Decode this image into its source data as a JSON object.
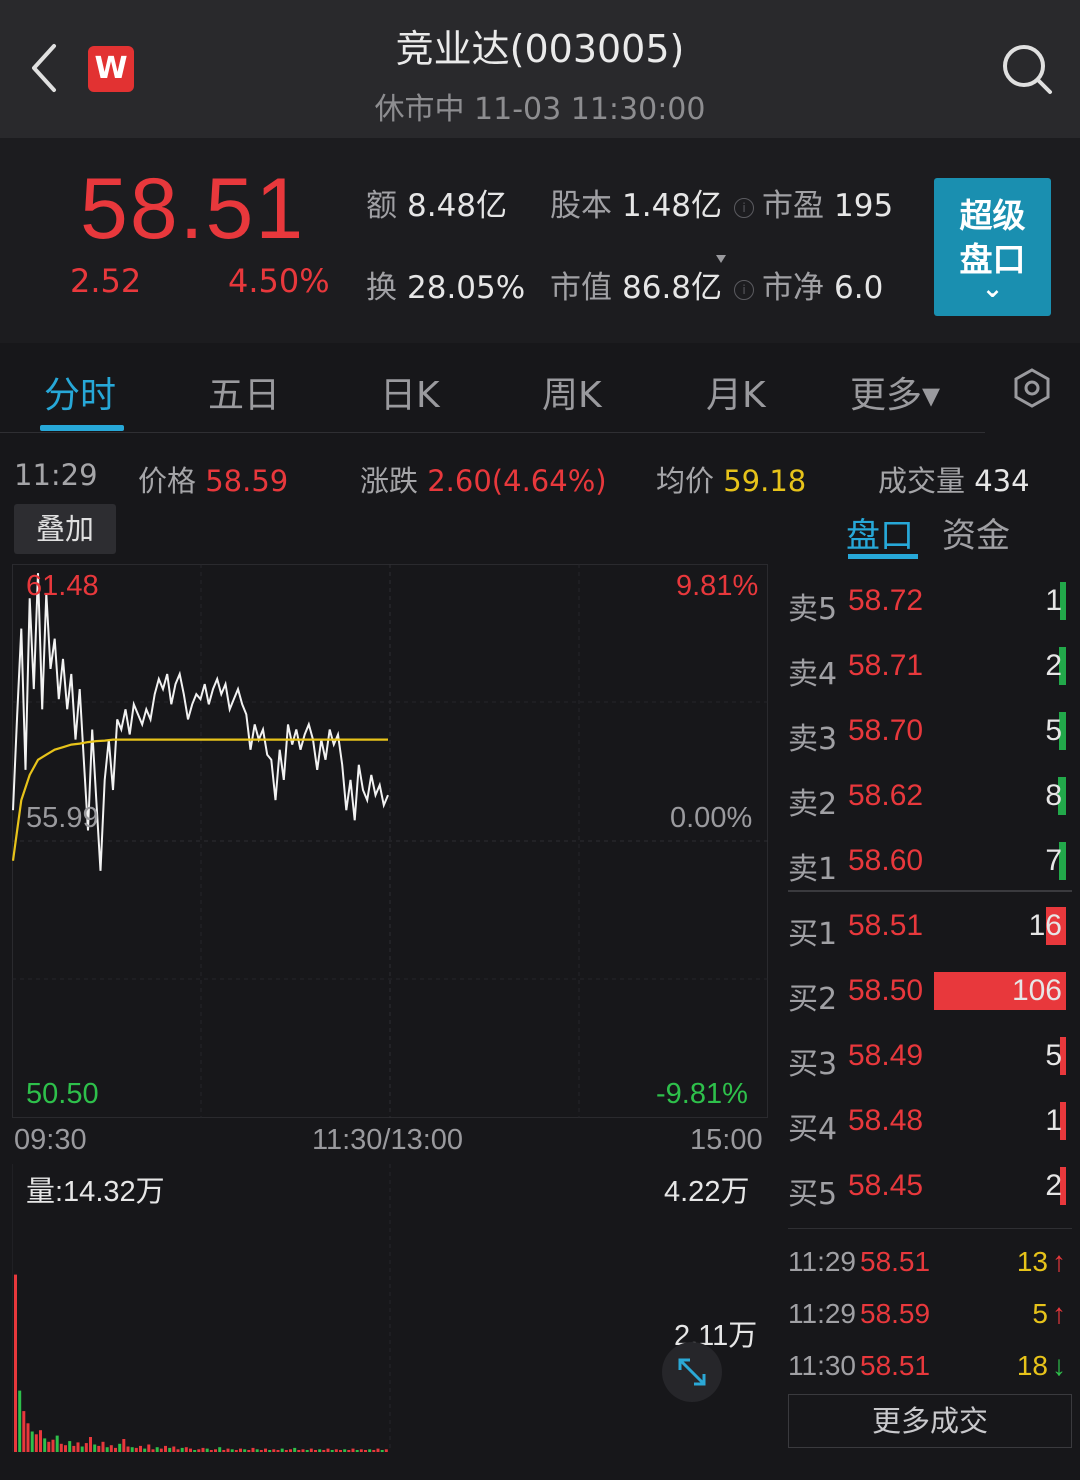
{
  "header": {
    "title": "竞业达(003005)",
    "subtitle": "休市中 11-03 11:30:00",
    "logo_text": "W"
  },
  "quote": {
    "price": "58.51",
    "change": "2.52",
    "change_pct": "4.50%",
    "stats": [
      {
        "key": "额",
        "value": "8.48亿"
      },
      {
        "key": "股本",
        "value": "1.48亿"
      },
      {
        "key": "市盈",
        "value": "195"
      },
      {
        "key": "换",
        "value": "28.05%"
      },
      {
        "key": "市值",
        "value": "86.8亿"
      },
      {
        "key": "市净",
        "value": "6.0"
      }
    ],
    "super_button": {
      "line1": "超级",
      "line2": "盘口",
      "chevron": "⌄"
    }
  },
  "tabs": [
    "分时",
    "五日",
    "日K",
    "周K",
    "月K",
    "更多▾"
  ],
  "info_row": {
    "time": "11:29",
    "price_label": "价格",
    "price": "58.59",
    "change_label": "涨跌",
    "change": "2.60(4.64%)",
    "avg_label": "均价",
    "avg": "59.18",
    "volume_label": "成交量",
    "volume": "434"
  },
  "overlay_button": "叠加",
  "orderbook_tabs": [
    "盘口",
    "资金"
  ],
  "chart_data": {
    "type": "line",
    "y_left": {
      "max": "61.48",
      "mid": "55.99",
      "min": "50.50"
    },
    "y_right": {
      "max": "9.81%",
      "mid": "0.00%",
      "min": "-9.81%"
    },
    "x_ticks": [
      "09:30",
      "11:30/13:00",
      "15:00"
    ],
    "ylim": [
      50.5,
      61.48
    ],
    "series": [
      {
        "color": "#f2f2f2",
        "values": [
          56.6,
          58.5,
          60.2,
          57.4,
          60.8,
          59.0,
          61.3,
          58.6,
          60.9,
          59.4,
          60.0,
          58.8,
          59.6,
          58.6,
          59.3,
          58.0,
          59.0,
          57.6,
          56.2,
          58.2,
          56.8,
          55.4,
          57.2,
          58.0,
          57.0,
          58.4,
          58.2,
          58.6,
          58.1,
          58.7,
          58.5,
          58.3,
          58.6,
          58.4,
          58.9,
          59.2,
          59.0,
          59.3,
          58.7,
          59.1,
          59.3,
          58.9,
          58.4,
          58.7,
          58.9,
          58.8,
          59.1,
          58.7,
          59.0,
          59.2,
          58.9,
          59.1,
          58.6,
          58.8,
          59.0,
          58.7,
          58.5,
          57.8,
          58.3,
          58.0,
          58.2,
          57.7,
          57.6,
          56.8,
          57.8,
          57.2,
          58.3,
          57.9,
          58.2,
          57.8,
          58.1,
          58.3,
          58.0,
          57.4,
          58.0,
          57.6,
          58.2,
          57.9,
          58.1,
          57.5,
          56.6,
          57.2,
          56.4,
          57.5,
          57.0,
          56.8,
          57.3,
          56.9,
          57.1,
          56.7,
          56.9
        ]
      },
      {
        "color": "#e7c31a",
        "values": [
          55.6,
          56.8,
          57.3,
          57.6,
          57.7,
          57.8,
          57.85,
          57.9,
          57.92,
          57.95,
          57.97,
          57.98,
          58.0,
          58.0,
          58.0,
          58.0,
          58.0,
          58.0,
          58.0,
          58.0,
          58.0,
          58.0,
          58.0,
          58.0,
          58.0,
          58.0,
          58.0,
          58.0,
          58.0,
          58.0,
          58.0,
          58.0,
          58.0,
          58.0,
          58.0,
          58.0,
          58.0,
          58.0,
          58.0,
          58.0,
          58.0,
          58.0,
          58.0,
          58.0,
          58.0,
          58.0
        ]
      }
    ],
    "volume": {
      "label": "量:14.32万",
      "max_label": "4.22万",
      "mid_label": "2.11万",
      "max": 42200,
      "values": [
        26000,
        9000,
        6000,
        4200,
        3000,
        2600,
        3200,
        2000,
        1500,
        1800,
        2400,
        1200,
        1000,
        1600,
        900,
        1400,
        800,
        1300,
        2200,
        1100,
        900,
        1500,
        700,
        1000,
        600,
        1200,
        1900,
        800,
        700,
        600,
        900,
        500,
        1100,
        400,
        700,
        500,
        900,
        600,
        800,
        400,
        600,
        700,
        500,
        300,
        400,
        600,
        500,
        300,
        400,
        700,
        300,
        500,
        400,
        300,
        500,
        400,
        300,
        600,
        400,
        300,
        500,
        300,
        400,
        300,
        500,
        300,
        400,
        600,
        300,
        400,
        300,
        500,
        300,
        400,
        300,
        500,
        300,
        400,
        300,
        400,
        300,
        500,
        300,
        400,
        300,
        400,
        300,
        500,
        300,
        400
      ]
    }
  },
  "order_book": {
    "asks": [
      {
        "label": "卖5",
        "price": "58.72",
        "qty": "1",
        "fill": 0.04
      },
      {
        "label": "卖4",
        "price": "58.71",
        "qty": "2",
        "fill": 0.05
      },
      {
        "label": "卖3",
        "price": "58.70",
        "qty": "5",
        "fill": 0.05
      },
      {
        "label": "卖2",
        "price": "58.62",
        "qty": "8",
        "fill": 0.06
      },
      {
        "label": "卖1",
        "price": "58.60",
        "qty": "7",
        "fill": 0.05
      }
    ],
    "bids": [
      {
        "label": "买1",
        "price": "58.51",
        "qty": "16",
        "fill": 0.15
      },
      {
        "label": "买2",
        "price": "58.50",
        "qty": "106",
        "fill": 1.0
      },
      {
        "label": "买3",
        "price": "58.49",
        "qty": "5",
        "fill": 0.04
      },
      {
        "label": "买4",
        "price": "58.48",
        "qty": "1",
        "fill": 0.03
      },
      {
        "label": "买5",
        "price": "58.45",
        "qty": "2",
        "fill": 0.03
      }
    ],
    "ask_bar_color": "#22a84a",
    "bid_bar_color": "#e8383c"
  },
  "ticks": [
    {
      "time": "11:29",
      "price": "58.51",
      "qty": "13",
      "dir": "↑"
    },
    {
      "time": "11:29",
      "price": "58.59",
      "qty": "5",
      "dir": "↑"
    },
    {
      "time": "11:30",
      "price": "58.51",
      "qty": "18",
      "dir": "↓"
    }
  ],
  "more_trades": "更多成交"
}
